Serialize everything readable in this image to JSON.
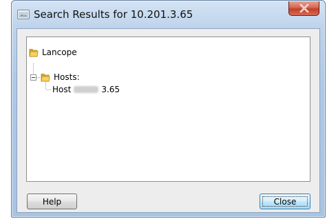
{
  "window": {
    "title": "Search Results for 10.201.3.65",
    "close_icon": "close-x-icon"
  },
  "tree": {
    "root": {
      "label": "Lancope",
      "icon": "folder-icon"
    },
    "group": {
      "label": "Hosts:",
      "icon": "folder-icon",
      "expanded": true
    },
    "host": {
      "prefix": "Host",
      "suffix": "3.65"
    }
  },
  "buttons": {
    "help_label": "Help",
    "close_label": "Close"
  },
  "colors": {
    "close_button": "#c9452e",
    "focused_button_border": "#3c7fb1",
    "folder": "#e8b730"
  }
}
